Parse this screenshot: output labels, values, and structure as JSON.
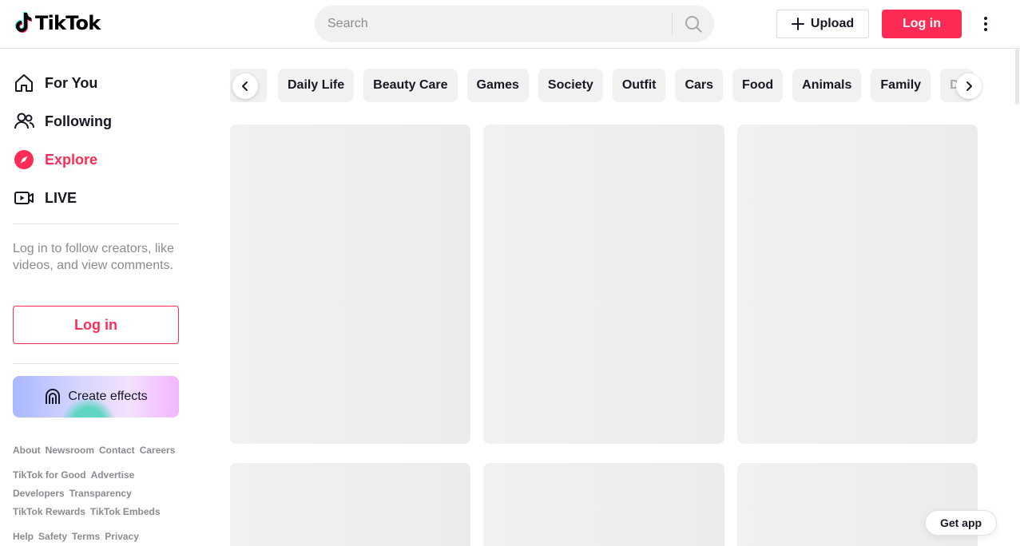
{
  "header": {
    "logo_text": "TikTok",
    "search_placeholder": "Search",
    "upload_label": "Upload",
    "login_label": "Log in"
  },
  "sidebar": {
    "nav": [
      {
        "label": "For You",
        "icon": "home-icon",
        "active": false
      },
      {
        "label": "Following",
        "icon": "following-icon",
        "active": false
      },
      {
        "label": "Explore",
        "icon": "compass-icon",
        "active": true
      },
      {
        "label": "LIVE",
        "icon": "live-icon",
        "active": false
      }
    ],
    "login_tip": "Log in to follow creators, like videos, and view comments.",
    "login_label": "Log in",
    "effects_label": "Create effects",
    "footer_rows": [
      [
        "About",
        "Newsroom",
        "Contact",
        "Careers"
      ],
      [
        "TikTok for Good",
        "Advertise"
      ],
      [
        "Developers",
        "Transparency"
      ],
      [
        "TikTok Rewards",
        "TikTok Embeds"
      ],
      [
        "Help",
        "Safety",
        "Terms",
        "Privacy"
      ]
    ]
  },
  "categories": [
    "Daily Life",
    "Beauty Care",
    "Games",
    "Society",
    "Outfit",
    "Cars",
    "Food",
    "Animals",
    "Family",
    "Dr"
  ],
  "get_app_label": "Get app",
  "colors": {
    "accent": "#fe2c55",
    "chip_bg": "#f1f1f2",
    "placeholder": "#f1f1f2"
  }
}
